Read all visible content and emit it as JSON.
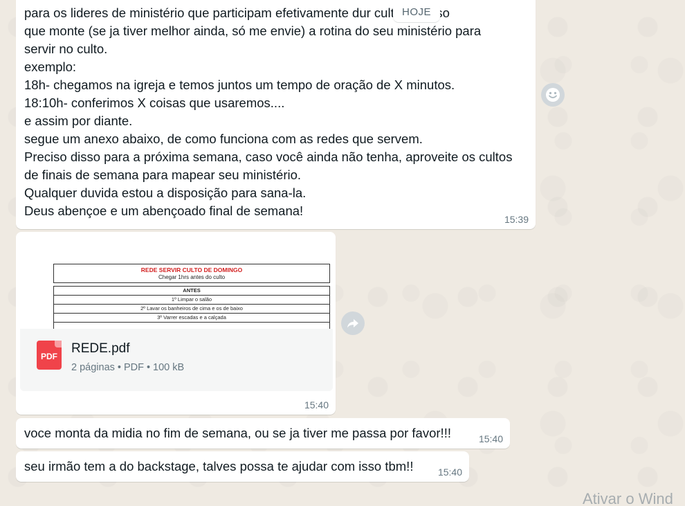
{
  "date_chip": "HOJE",
  "messages": [
    {
      "text": "para os lideres de ministério que participam efetivamente dur          culto, preciso\nque monte (se ja tiver melhor ainda, só me envie) a rotina do seu ministério para\nservir no culto.\nexemplo:\n18h- chegamos na igreja e temos juntos um tempo de oração de X minutos.\n18:10h- conferimos X coisas que usaremos....\ne assim por diante.\nsegue um anexo abaixo, de como funciona com as redes que servem.\nPreciso disso para a próxima semana, caso você ainda não tenha, aproveite os cultos\nde finais de semana para mapear seu ministério.\nQualquer duvida estou a disposição para sana-la.\nDeus abençoe e um abençoado final de semana!",
      "time": "15:39"
    },
    {
      "file": {
        "name": "REDE.pdf",
        "pages": "2 páginas",
        "type": "PDF",
        "size": "100 kB",
        "icon_label": "PDF",
        "preview": {
          "title": "REDE SERVIR CULTO DE DOMINGO",
          "subtitle": "Chegar 1hrs antes do culto",
          "section": "ANTES",
          "rows": [
            "1º Limpar o salão",
            "2º Lavar os banheiros de cima e os de baixo",
            "3º Varrer escadas e a calçada"
          ]
        }
      },
      "time": "15:40"
    },
    {
      "text": "voce monta da midia no fim de semana, ou se ja tiver me passa por favor!!!",
      "time": "15:40"
    },
    {
      "text": "seu irmão tem a do backstage, talves possa te ajudar com isso tbm!!",
      "time": "15:40"
    }
  ],
  "watermark": "Ativar o Wind",
  "colors": {
    "chat_bg": "#efeae2",
    "bubble_bg": "#ffffff",
    "time_text": "#667781",
    "pdf_red": "#f0434a"
  },
  "icons": [
    "emoji-reaction-icon",
    "forward-icon",
    "pdf-file-icon"
  ]
}
